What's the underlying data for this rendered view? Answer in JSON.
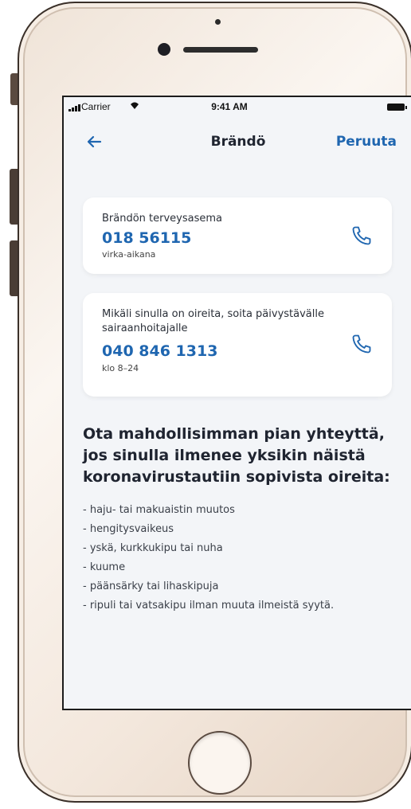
{
  "status_bar": {
    "carrier": "Carrier",
    "time": "9:41 AM"
  },
  "nav": {
    "title": "Brändö",
    "cancel_label": "Peruuta"
  },
  "contacts": [
    {
      "label": "Brändön terveysasema",
      "number": "018 56115",
      "note": "virka-aikana"
    },
    {
      "label": "Mikäli sinulla on oireita, soita päivystävälle sairaanhoitajalle",
      "number": "040 846 1313",
      "note": "klo 8–24"
    }
  ],
  "info": {
    "heading": "Ota mahdollisimman pian yhteyttä, jos sinulla ilmenee yksikin näistä koronavirustautiin sopivista oireita:",
    "symptoms": [
      "- haju- tai makuaistin muutos",
      "- hengitysvaikeus",
      "- yskä, kurkkukipu tai nuha",
      "- kuume",
      "- päänsärky tai lihaskipuja",
      "- ripuli tai vatsakipu ilman muuta ilmeistä syytä."
    ]
  },
  "colors": {
    "accent": "#1f66b0",
    "background": "#f3f5f8",
    "card": "#ffffff",
    "text": "#1f2430"
  }
}
